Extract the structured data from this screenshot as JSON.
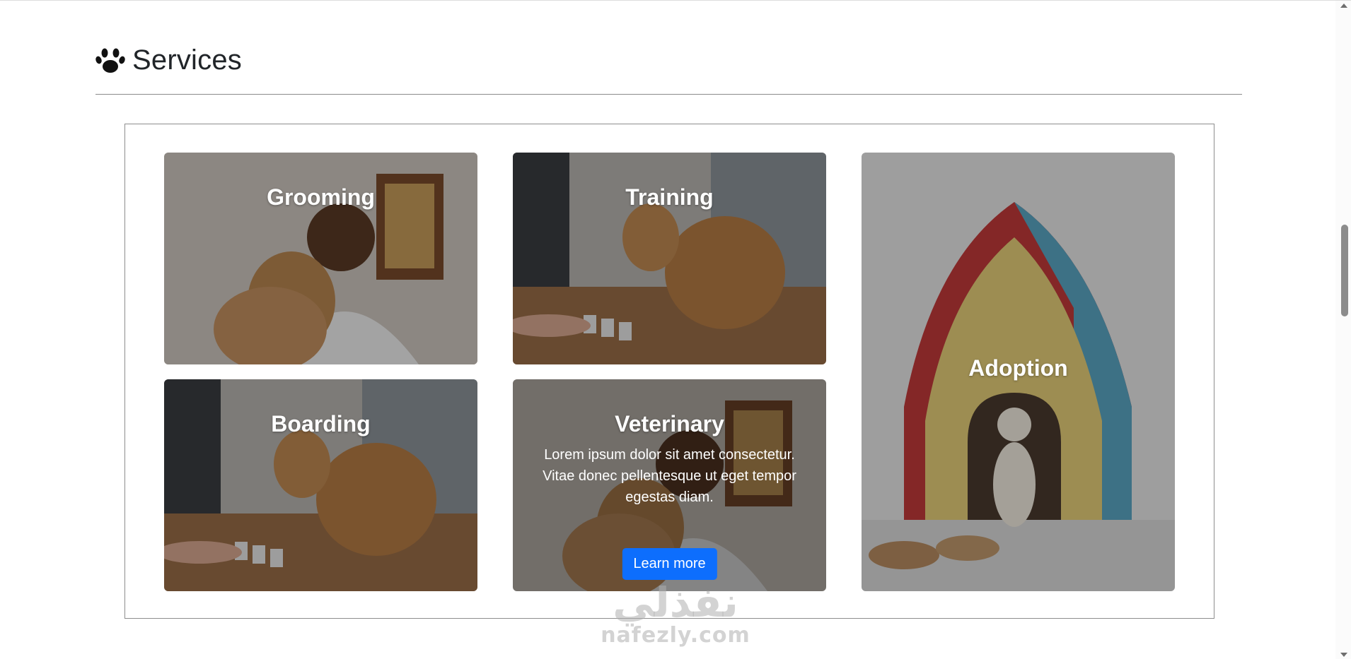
{
  "section": {
    "title": "Services",
    "icon": "paw-icon"
  },
  "cards": {
    "grooming": {
      "title": "Grooming"
    },
    "training": {
      "title": "Training"
    },
    "adoption": {
      "title": "Adoption"
    },
    "boarding": {
      "title": "Boarding"
    },
    "veterinary": {
      "title": "Veterinary",
      "text": "Lorem ipsum dolor sit amet consectetur. Vitae donec pellentesque ut eget tempor egestas diam.",
      "button_label": "Learn more"
    }
  },
  "watermark": {
    "arabic": "نفذلي",
    "latin": "nafezly.com"
  },
  "colors": {
    "button": "#0d6efd",
    "title": "#212529"
  }
}
